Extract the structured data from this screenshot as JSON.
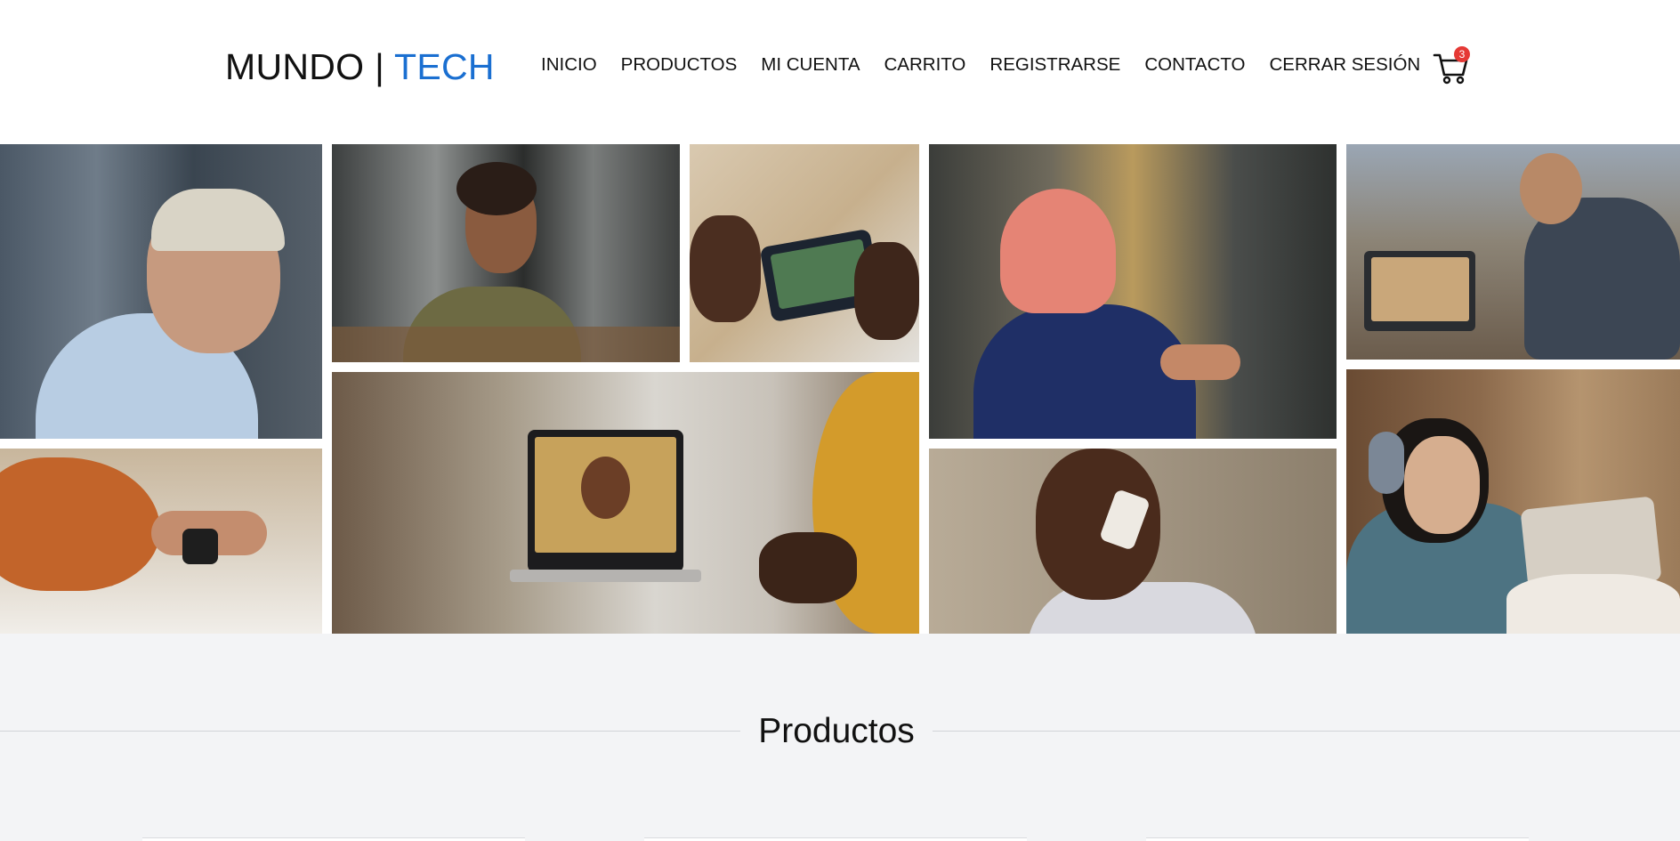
{
  "header": {
    "logo_part1": "MUNDO",
    "logo_separator": "|",
    "logo_part2": "TECH",
    "nav": [
      "INICIO",
      "PRODUCTOS",
      "MI CUENTA",
      "CARRITO",
      "REGISTRARSE",
      "CONTACTO",
      "CERRAR SESIÓN"
    ],
    "cart_icon": "shopping-cart-icon",
    "cart_count": "3"
  },
  "products": {
    "title": "Productos"
  },
  "colors": {
    "brand_accent": "#1a6fd1",
    "badge": "#e53935",
    "section_bg": "#f3f4f6"
  }
}
